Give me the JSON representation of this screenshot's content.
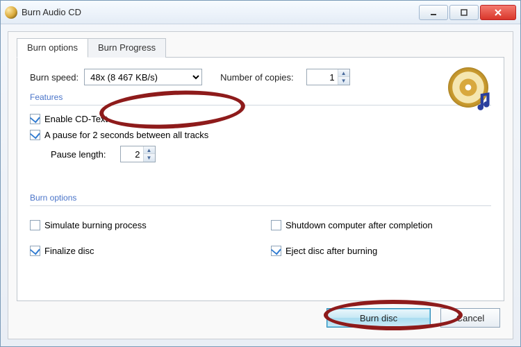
{
  "window": {
    "title": "Burn Audio CD"
  },
  "tabs": {
    "options": "Burn options",
    "progress": "Burn Progress"
  },
  "speed": {
    "label": "Burn speed:",
    "value": "48x (8 467 KB/s)"
  },
  "copies": {
    "label": "Number of copies:",
    "value": "1"
  },
  "features": {
    "heading": "Features",
    "cdtext": {
      "label": "Enable CD-Text",
      "checked": true
    },
    "pause": {
      "label": "A pause for 2 seconds between all tracks",
      "checked": true
    },
    "pause_len": {
      "label": "Pause length:",
      "value": "2"
    }
  },
  "burn_options": {
    "heading": "Burn options",
    "simulate": {
      "label": "Simulate burning process",
      "checked": false
    },
    "shutdown": {
      "label": "Shutdown computer after completion",
      "checked": false
    },
    "finalize": {
      "label": "Finalize disc",
      "checked": true
    },
    "eject": {
      "label": "Eject disc after burning",
      "checked": true
    }
  },
  "buttons": {
    "burn": "Burn disc",
    "cancel": "Cancel"
  }
}
